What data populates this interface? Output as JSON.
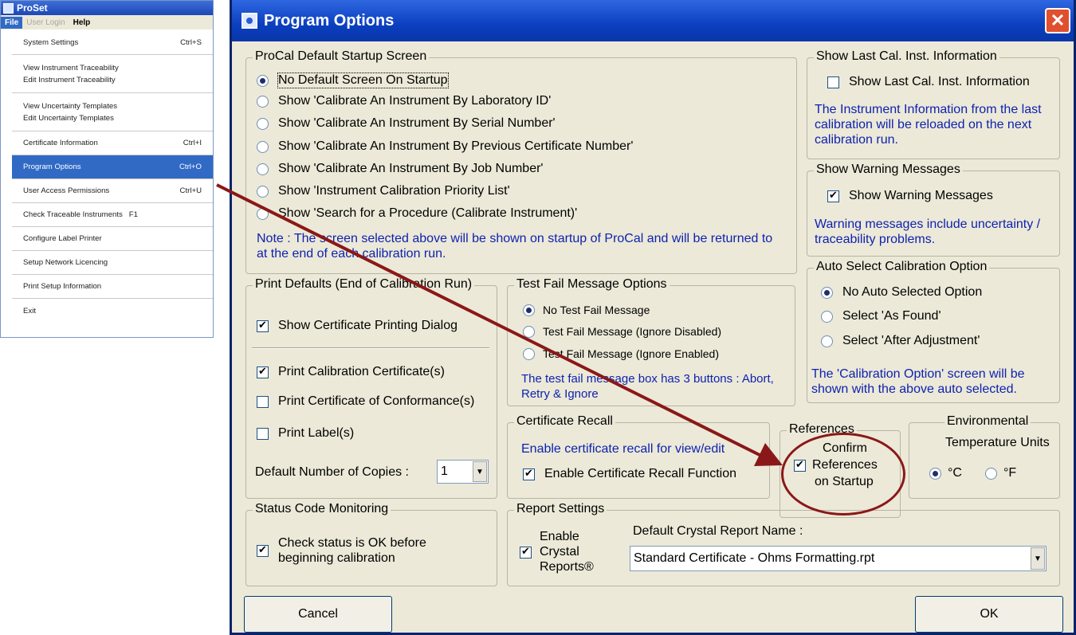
{
  "menu_window": {
    "title": "ProSet",
    "menubar": {
      "file": "File",
      "user_login": "User Login",
      "help": "Help"
    },
    "items": [
      {
        "label": "System Settings",
        "shortcut": "Ctrl+S"
      },
      {
        "label": "View Instrument Traceability",
        "label2": "Edit Instrument Traceability"
      },
      {
        "label": "View Uncertainty Templates",
        "label2": "Edit Uncertainty Templates"
      },
      {
        "label": "Certificate Information",
        "shortcut": "Ctrl+I"
      },
      {
        "label": "Program Options",
        "shortcut": "Ctrl+O"
      },
      {
        "label": "User Access Permissions",
        "shortcut": "Ctrl+U"
      },
      {
        "label": "Check Traceable Instruments",
        "shortcut": "F1"
      },
      {
        "label": "Configure Label Printer"
      },
      {
        "label": "Setup Network Licencing"
      },
      {
        "label": "Print Setup Information"
      },
      {
        "label": "Exit"
      }
    ]
  },
  "dialog": {
    "title": "Program Options",
    "close": "✕",
    "startup": {
      "legend": "ProCal Default Startup Screen",
      "options": [
        "No Default Screen On Startup",
        "Show 'Calibrate An Instrument By Laboratory ID'",
        "Show 'Calibrate An Instrument By Serial Number'",
        "Show 'Calibrate An Instrument By Previous Certificate Number'",
        "Show 'Calibrate An Instrument By Job Number'",
        "Show 'Instrument Calibration Priority List'",
        "Show 'Search for a Procedure (Calibrate Instrument)'"
      ],
      "note": "Note : The screen selected above will be shown on startup of ProCal and will be returned to at the end of each calibration run."
    },
    "last_cal": {
      "legend": "Show Last Cal. Inst. Information",
      "checkbox": "Show Last Cal. Inst. Information",
      "note": "The Instrument Information from the last calibration will be reloaded on the next calibration run."
    },
    "warnings": {
      "legend": "Show Warning Messages",
      "checkbox": "Show Warning Messages",
      "note": "Warning messages include uncertainty / traceability problems."
    },
    "auto_select": {
      "legend": "Auto Select Calibration Option",
      "options": [
        "No Auto Selected Option",
        "Select 'As Found'",
        "Select 'After Adjustment'"
      ],
      "note": "The 'Calibration Option' screen will be shown with the above auto selected."
    },
    "print": {
      "legend": "Print Defaults (End of Calibration Run)",
      "show_dialog": "Show Certificate Printing Dialog",
      "print_cert": "Print Calibration Certificate(s)",
      "print_conf": "Print Certificate of Conformance(s)",
      "print_label": "Print Label(s)",
      "copies_label": "Default Number of Copies :",
      "copies_value": "1"
    },
    "test_fail": {
      "legend": "Test Fail Message Options",
      "options": [
        "No Test Fail Message",
        "Test Fail Message (Ignore Disabled)",
        "Test Fail Message (Ignore Enabled)"
      ],
      "note": "The test fail message box has 3 buttons : Abort, Retry & Ignore"
    },
    "recall": {
      "legend": "Certificate Recall",
      "note": "Enable certificate recall for view/edit",
      "checkbox": "Enable Certificate Recall Function"
    },
    "references": {
      "legend": "References",
      "line1": "Confirm",
      "line2": "References",
      "line3": "on Startup"
    },
    "environment": {
      "legend1": "Environmental",
      "legend2": "Temperature Units",
      "celsius": "°C",
      "fahrenheit": "°F"
    },
    "status": {
      "legend": "Status Code Monitoring",
      "line1": "Check status is OK before",
      "line2": "beginning calibration"
    },
    "report": {
      "legend": "Report Settings",
      "enable1": "Enable",
      "enable2": "Crystal",
      "enable3": "Reports®",
      "default_label": "Default Crystal Report Name :",
      "default_value": "Standard Certificate - Ohms Formatting.rpt"
    },
    "cancel": "Cancel",
    "ok": "OK"
  },
  "colors": {
    "title_blue": "#0b3fbf",
    "note_blue": "#0f22b0",
    "arrow_red": "#8a1818",
    "face": "#ece9d8"
  }
}
